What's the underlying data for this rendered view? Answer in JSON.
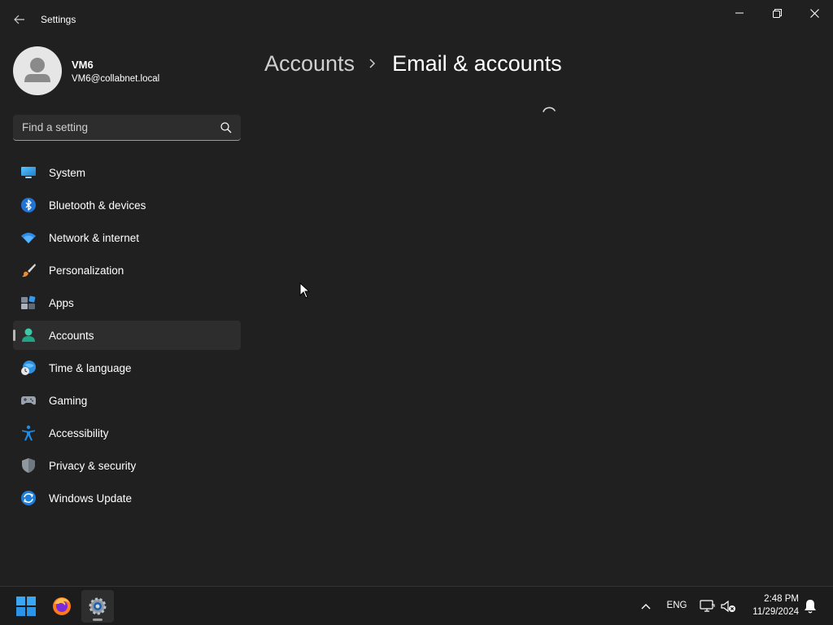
{
  "window": {
    "title": "Settings"
  },
  "profile": {
    "name": "VM6",
    "email": "VM6@collabnet.local"
  },
  "search": {
    "placeholder": "Find a setting"
  },
  "nav": {
    "items": [
      {
        "label": "System",
        "icon": "system-icon"
      },
      {
        "label": "Bluetooth & devices",
        "icon": "bluetooth-icon"
      },
      {
        "label": "Network & internet",
        "icon": "wifi-icon"
      },
      {
        "label": "Personalization",
        "icon": "brush-icon"
      },
      {
        "label": "Apps",
        "icon": "apps-icon"
      },
      {
        "label": "Accounts",
        "icon": "accounts-icon",
        "selected": true
      },
      {
        "label": "Time & language",
        "icon": "time-language-icon"
      },
      {
        "label": "Gaming",
        "icon": "gamepad-icon"
      },
      {
        "label": "Accessibility",
        "icon": "accessibility-icon"
      },
      {
        "label": "Privacy & security",
        "icon": "shield-icon"
      },
      {
        "label": "Windows Update",
        "icon": "update-icon"
      }
    ]
  },
  "breadcrumb": {
    "parent": "Accounts",
    "current": "Email & accounts"
  },
  "taskbar": {
    "apps": [
      "start",
      "firefox",
      "settings"
    ],
    "language": "ENG",
    "time": "2:48 PM",
    "date": "11/29/2024"
  },
  "colors": {
    "background": "#202020",
    "nav_selected": "#2d2d2d",
    "accent": "#0078d4"
  }
}
